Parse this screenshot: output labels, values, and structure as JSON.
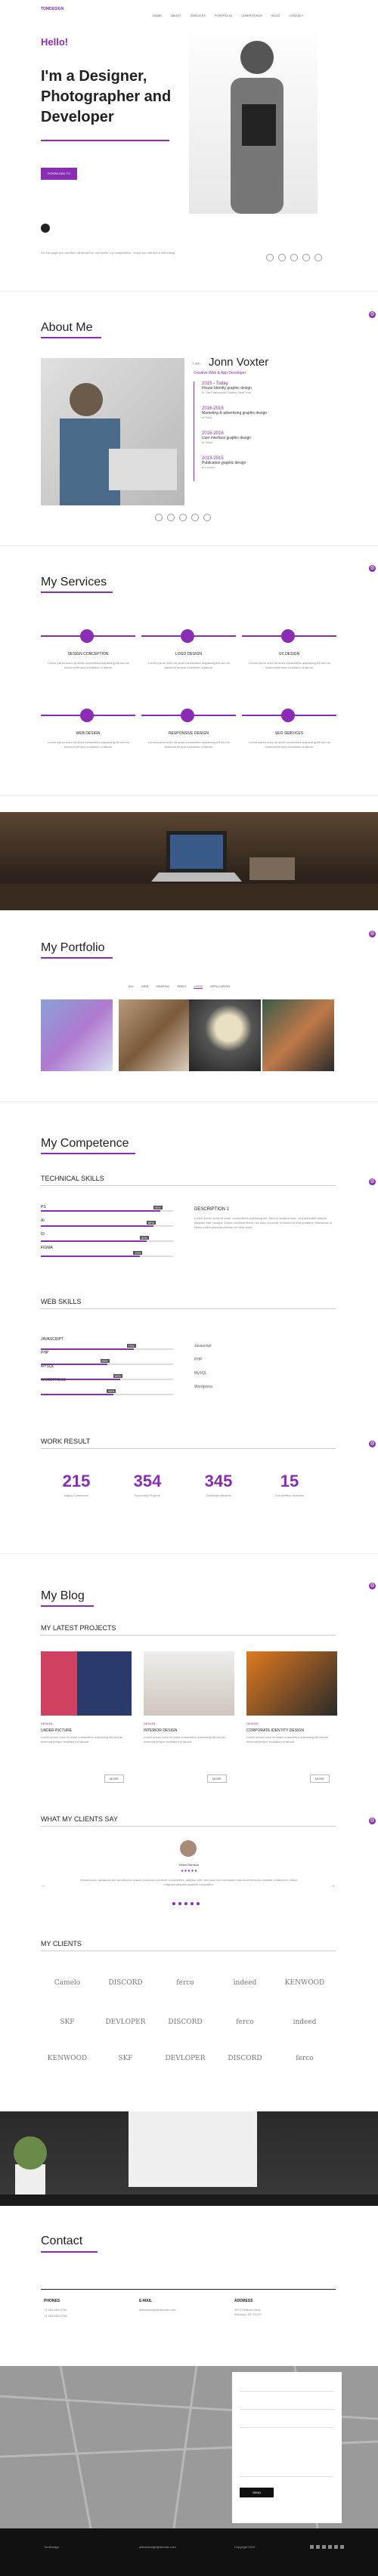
{
  "brand": "TOMDESIGN",
  "nav": [
    "HOME",
    "ABOUT",
    "SERVICES",
    "PORTFOLIO",
    "COMPETENCE",
    "BLOG",
    "CONTACT"
  ],
  "hero": {
    "hello": "Hello!",
    "headline": "I'm a Designer, Photographer and Developer",
    "button": "DOWNLOAD CV",
    "body": "On this page you can find out about me, my works, my competence. I hope you will find it interesting."
  },
  "about": {
    "title": "About Me",
    "name_prefix": "I am",
    "name": "Jonn Voxter",
    "role": "Creative Web & App Developer",
    "timeline": [
      {
        "years": "2015 - Today",
        "role": "House Identity graphic design",
        "place": "in The Frameword Gallery, New York"
      },
      {
        "years": "2016-2018",
        "role": "Marketing & advertising graphic design",
        "place": "in Paris"
      },
      {
        "years": "2016-2018",
        "role": "User interface graphic design",
        "place": "in Tokyo"
      },
      {
        "years": "2013-2015",
        "role": "Publication graphic design",
        "place": "in London"
      }
    ]
  },
  "services": {
    "title": "My Services",
    "items": [
      {
        "name": "DESIGN CONCEPTION",
        "icon": "bulb-icon"
      },
      {
        "name": "LOGO DESIGN",
        "icon": "pen-icon"
      },
      {
        "name": "UX DESIGN",
        "icon": "monitor-icon"
      },
      {
        "name": "WEB DESIGN",
        "icon": "globe-icon"
      },
      {
        "name": "RESPONSIVE DESIGN",
        "icon": "phone-icon"
      },
      {
        "name": "SEO SERVICES",
        "icon": "chart-icon"
      }
    ],
    "desc": "Lorem ipsum dolor sit amet consectetur adipiscing elit sed do eiusmod tempor incididunt ut labore."
  },
  "portfolio": {
    "title": "My Portfolio",
    "filters": [
      "ALL",
      "WEB",
      "GRAPHIC",
      "PRINT",
      "LOGO",
      "APPLICATION"
    ],
    "active_filter": "LOGO"
  },
  "competence": {
    "title": "My Competence",
    "tech_title": "TECHNICAL SKILLS",
    "tech": [
      {
        "name": "PS",
        "pct": "90%"
      },
      {
        "name": "AI",
        "pct": "85%"
      },
      {
        "name": "ID",
        "pct": "80%"
      },
      {
        "name": "FIGMA",
        "pct": "75%"
      }
    ],
    "desc_title": "DESCRIPTION 1",
    "web_title": "WEB SKILLS",
    "web": [
      {
        "name": "JAVASCRIPT",
        "pct": "70%"
      },
      {
        "name": "PHP",
        "pct": "50%"
      },
      {
        "name": "MYSQL",
        "pct": "60%"
      },
      {
        "name": "WORDPRESS",
        "pct": "55%"
      }
    ],
    "web_list": [
      "Javascript",
      "PHP",
      "MySQL",
      "Wordpress"
    ],
    "work_title": "WORK RESULT",
    "work": [
      {
        "num": "215",
        "label": "Happy Customers"
      },
      {
        "num": "354",
        "label": "Succesfull Projects"
      },
      {
        "num": "345",
        "label": "Developed Brands"
      },
      {
        "num": "15",
        "label": "Competition Victories"
      }
    ]
  },
  "blog": {
    "title": "My Blog",
    "projects_title": "MY LATEST PROJECTS",
    "posts": [
      {
        "tag": "DESIGN",
        "title": "UNDER PICTURE",
        "btn": "MORE"
      },
      {
        "tag": "DESIGN",
        "title": "INTERIOR DESIGN",
        "btn": "MORE"
      },
      {
        "tag": "DESIGN",
        "title": "CORPORATE IDENTITY DESIGN",
        "btn": "MORE"
      }
    ],
    "clients_say": "WHAT MY CLIENTS SAY",
    "testimonial_name": "Helen Harrison",
    "testimonial_text": "Neque porro quisquam est qui dolorem ipsum quia dolor sit amet, consectetur, adipisci velit, sed quia non numquam eius modi tempora incidunt ut labore et dolore magnam aliquam quaerat voluptatem.",
    "clients_title": "MY CLIENTS",
    "clients": [
      "Camelo",
      "DISCORD",
      "ferco",
      "indeed",
      "KENWOOD",
      "SKF",
      "DEVLOPER",
      "DISCORD",
      "ferco",
      "indeed",
      "KENWOOD",
      "SKF",
      "DEVLOPER",
      "DISCORD",
      "ferco"
    ]
  },
  "contact": {
    "title": "Contact",
    "phones_title": "PHONES",
    "phones": [
      "+1 555-555-5755",
      "+1 555-555-5756"
    ],
    "email_title": "E-MAIL",
    "email": "adtomdesign@domain.com",
    "address_title": "ADDRESS",
    "address": "4570 Redbud Drive, Brooklyn, NY 11219",
    "send": "SEND"
  },
  "footer": {
    "col1": "TomDesign",
    "col2": "adtomdesign@domain.com",
    "col3": "Copyright 2019"
  },
  "colors": {
    "accent": "#8a2cb4"
  }
}
